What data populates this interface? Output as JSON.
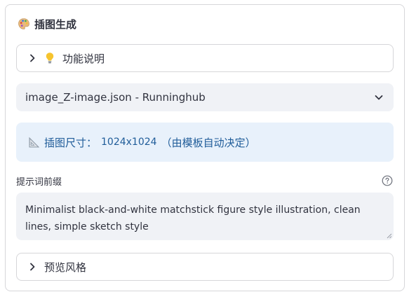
{
  "panel": {
    "title": "插图生成",
    "title_icon": "palette-icon"
  },
  "expander_help": {
    "icon": "lightbulb-icon",
    "label": "功能说明",
    "expanded": false
  },
  "template_select": {
    "value": "image_Z-image.json - Runninghub"
  },
  "info_box": {
    "icon": "triangular-ruler-icon",
    "label": "插图尺寸：",
    "size": "1024x1024",
    "note": "（由模板自动决定）"
  },
  "prompt_prefix": {
    "label": "提示词前缀",
    "value": "Minimalist black-and-white matchstick figure style illustration, clean lines, simple sketch style"
  },
  "expander_preview": {
    "label": "预览风格",
    "expanded": false
  },
  "colors": {
    "info_bg": "#e8f1fb",
    "info_text": "#1f5c99",
    "input_bg": "#f0f2f6",
    "border": "#d6d6d9"
  }
}
